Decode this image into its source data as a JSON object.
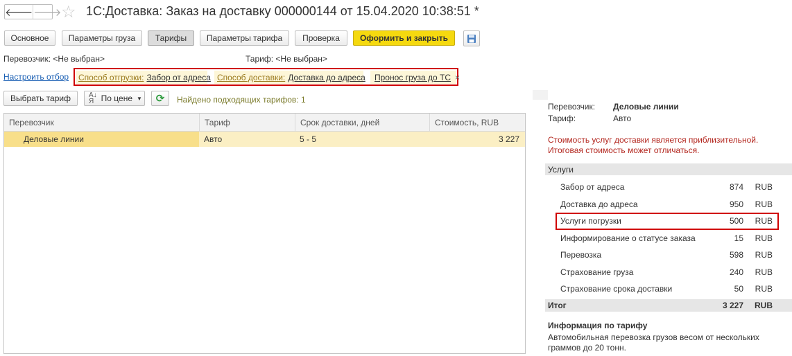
{
  "window": {
    "title": "1С:Доставка: Заказ на доставку 000000144 от 15.04.2020 10:38:51 *"
  },
  "tabs": {
    "basic": "Основное",
    "cargo": "Параметры груза",
    "tariffs": "Тарифы",
    "tariff_params": "Параметры тарифа",
    "check": "Проверка",
    "submit": "Оформить и закрыть"
  },
  "header_fields": {
    "carrier_label": "Перевозчик:",
    "carrier_value": "<Не выбран>",
    "tariff_label": "Тариф:",
    "tariff_value": "<Не выбран>"
  },
  "filter": {
    "configure_link": "Настроить отбор",
    "chips": [
      {
        "key": "Способ отгрузки:",
        "value": "Забор от адреса"
      },
      {
        "key": "Способ доставки:",
        "value": "Доставка до адреса"
      },
      {
        "key": "",
        "value": "Пронос груза до ТС",
        "close": "×"
      }
    ]
  },
  "toolbar": {
    "select_tariff": "Выбрать тариф",
    "sort_label": "По цене",
    "found_text": "Найдено подходящих тарифов: 1"
  },
  "table": {
    "columns": [
      "Перевозчик",
      "Тариф",
      "Срок доставки, дней",
      "Стоимость, RUB"
    ],
    "rows": [
      {
        "carrier": "Деловые линии",
        "tariff": "Авто",
        "term": "5 - 5",
        "cost": "3 227"
      }
    ]
  },
  "summary": {
    "carrier_label": "Перевозчик:",
    "carrier_value": "Деловые линии",
    "tariff_label": "Тариф:",
    "tariff_value": "Авто",
    "warning_line1": "Стоимость услуг доставки является приблизительной.",
    "warning_line2": "Итоговая стоимость может отличаться.",
    "services_header": "Услуги",
    "services": [
      {
        "name": "Забор от адреса",
        "amount": "874",
        "currency": "RUB"
      },
      {
        "name": "Доставка до адреса",
        "amount": "950",
        "currency": "RUB"
      },
      {
        "name": "Услуги погрузки",
        "amount": "500",
        "currency": "RUB"
      },
      {
        "name": "Информирование о статусе заказа",
        "amount": "15",
        "currency": "RUB"
      },
      {
        "name": "Перевозка",
        "amount": "598",
        "currency": "RUB"
      },
      {
        "name": "Страхование груза",
        "amount": "240",
        "currency": "RUB"
      },
      {
        "name": "Страхование срока доставки",
        "amount": "50",
        "currency": "RUB"
      }
    ],
    "total_label": "Итог",
    "total_amount": "3 227",
    "total_currency": "RUB",
    "tariff_info_title": "Информация по тарифу",
    "tariff_info_line1": "Автомобильная перевозка грузов весом от нескольких",
    "tariff_info_line2": "граммов до 20 тонн."
  },
  "colors": {
    "accent_yellow": "#f5d90f",
    "warning_red": "#b3261e",
    "highlight_border": "#d00000",
    "selected_row": "#fbefc4"
  }
}
